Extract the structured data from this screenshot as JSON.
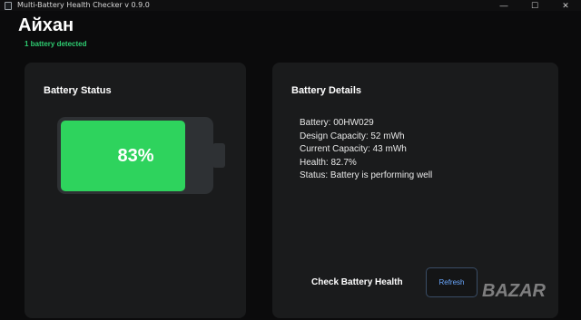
{
  "window": {
    "title": "Multi-Battery Health Checker v 0.9.0",
    "controls": {
      "minimize": "—",
      "maximize": "☐",
      "close": "✕"
    }
  },
  "header": {
    "user_name": "Айхан",
    "battery_count": "1 battery detected"
  },
  "battery_status": {
    "title": "Battery Status",
    "percent_label": "83%",
    "charge_level": 0.83,
    "fill_color": "#2ed35d"
  },
  "battery_details": {
    "title": "Battery Details",
    "lines": [
      "Battery: 00HW029",
      "Design Capacity: 52 mWh",
      "Current Capacity: 43 mWh",
      "Health: 82.7%",
      "Status: Battery is performing well"
    ]
  },
  "actions": {
    "check_label": "Check Battery Health",
    "refresh_label": "Refresh"
  },
  "watermark": {
    "text": "BAZAR"
  },
  "colors": {
    "accent_green": "#2ecc71",
    "button_text": "#6aa8ff",
    "card_bg": "#1a1b1c"
  }
}
